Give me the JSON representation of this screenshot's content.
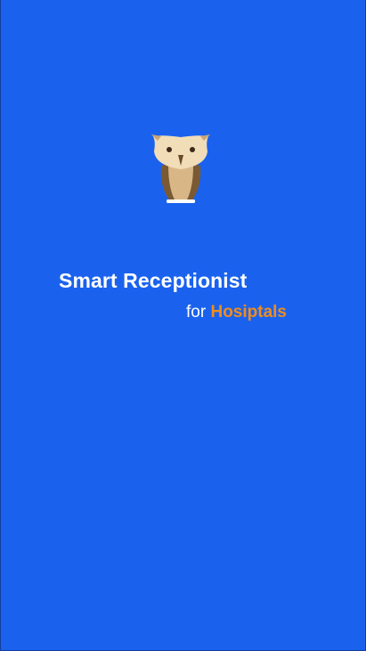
{
  "app": {
    "title": "Smart Receptionist",
    "subtitle_prefix": "for",
    "subtitle_highlight": "Hosiptals"
  },
  "icons": {
    "logo": "owl-icon"
  },
  "colors": {
    "background": "#1a62ee",
    "title_text": "#ffffff",
    "highlight": "#f08d1c"
  }
}
